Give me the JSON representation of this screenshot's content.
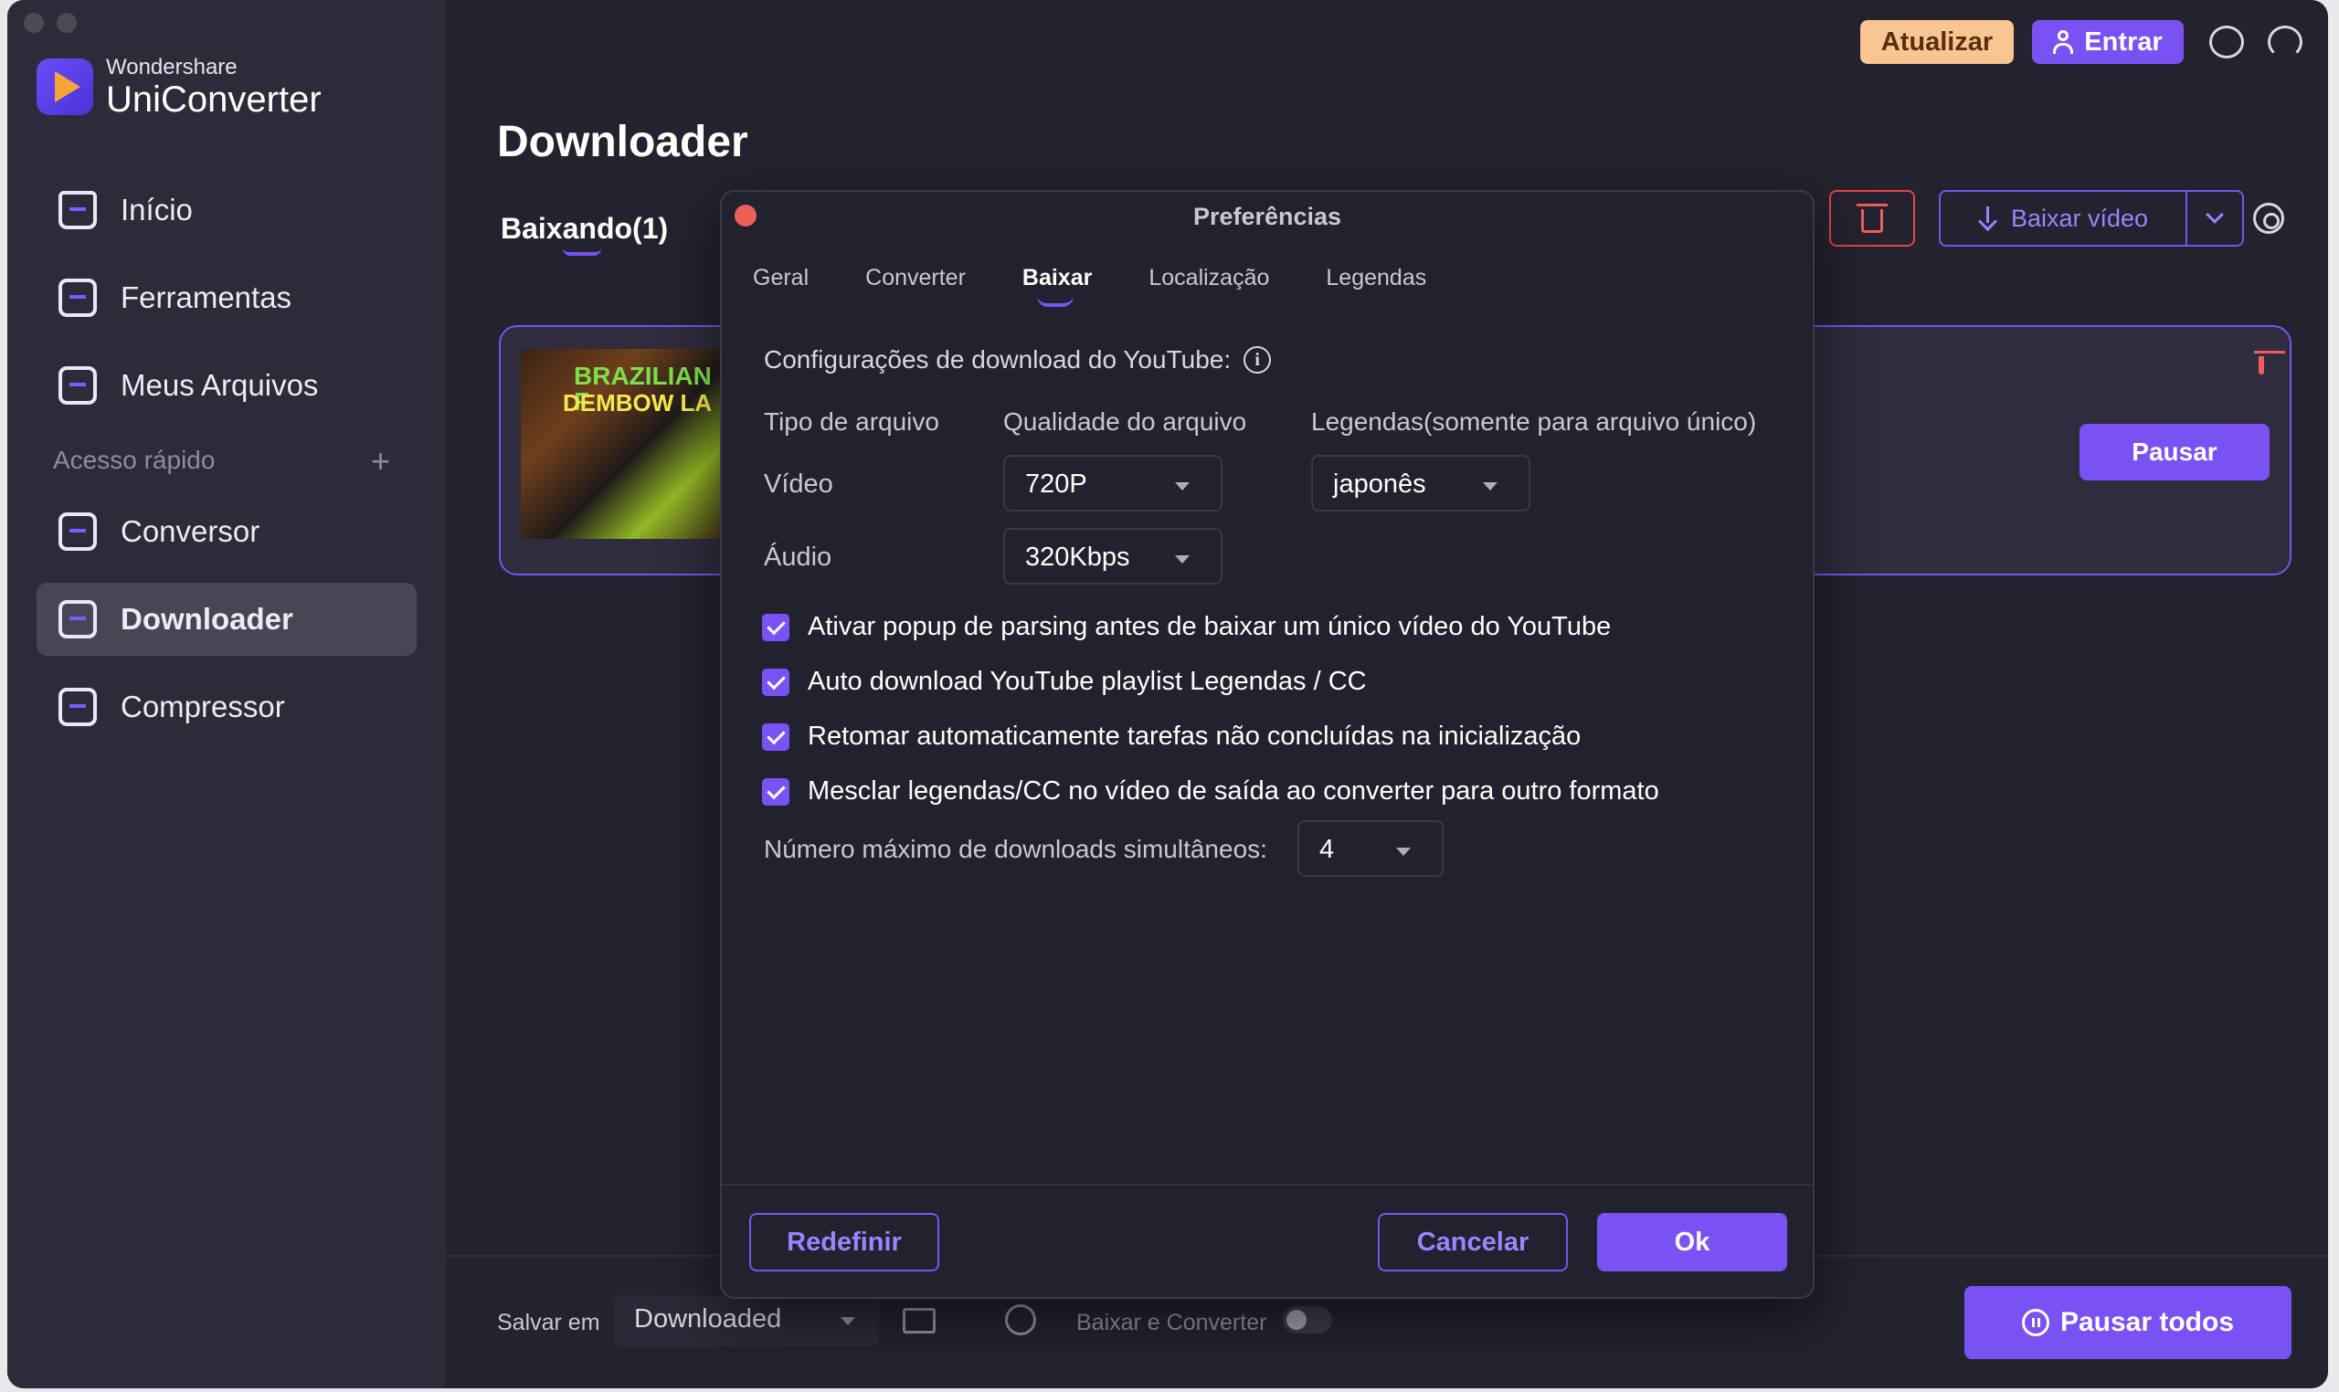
{
  "app": {
    "brand_small": "Wondershare",
    "brand_name": "UniConverter"
  },
  "sidebar": {
    "items": [
      {
        "label": "Início",
        "icon": "home-icon"
      },
      {
        "label": "Ferramentas",
        "icon": "toolbox-icon"
      },
      {
        "label": "Meus Arquivos",
        "icon": "files-icon"
      }
    ],
    "quick_access_label": "Acesso rápido",
    "quick_items": [
      {
        "label": "Conversor",
        "icon": "converter-icon"
      },
      {
        "label": "Downloader",
        "icon": "downloader-icon",
        "active": true
      },
      {
        "label": "Compressor",
        "icon": "compressor-icon"
      }
    ]
  },
  "header": {
    "update_label": "Atualizar",
    "login_label": "Entrar"
  },
  "main": {
    "title": "Downloader",
    "tab_downloading": "Baixando(1)",
    "download_video_label": "Baixar vídeo",
    "task": {
      "thumb_line1": "BRAZILIAN F",
      "thumb_line2": "DEMBOW LA",
      "pause_label": "Pausar"
    }
  },
  "footer": {
    "save_label": "Salvar em",
    "save_value": "Downloaded",
    "download_convert_label": "Baixar e Converter",
    "download_convert_on": false,
    "pause_all_label": "Pausar todos"
  },
  "dialog": {
    "title": "Preferências",
    "tabs": [
      "Geral",
      "Converter",
      "Baixar",
      "Localização",
      "Legendas"
    ],
    "active_tab": "Baixar",
    "section_title": "Configurações de download do YouTube:",
    "col_type": "Tipo de arquivo",
    "col_quality": "Qualidade do arquivo",
    "col_subtitles": "Legendas(somente para arquivo único)",
    "row_video": "Vídeo",
    "row_audio": "Áudio",
    "video_quality": "720P",
    "audio_quality": "320Kbps",
    "subtitle_language": "japonês",
    "checkboxes": [
      {
        "label": "Ativar popup de parsing antes de baixar um único vídeo do YouTube",
        "checked": true
      },
      {
        "label": "Auto download YouTube playlist Legendas / CC",
        "checked": true
      },
      {
        "label": "Retomar automaticamente tarefas não concluídas na inicialização",
        "checked": true
      },
      {
        "label": "Mesclar legendas/CC no vídeo de saída ao converter para outro formato",
        "checked": true
      }
    ],
    "max_downloads_label": "Número máximo de downloads simultâneos:",
    "max_downloads_value": "4",
    "reset_label": "Redefinir",
    "cancel_label": "Cancelar",
    "ok_label": "Ok"
  },
  "colors": {
    "accent": "#7a52f4",
    "update_bg": "#f9c592",
    "danger": "#e54545",
    "background": "#23222e"
  }
}
